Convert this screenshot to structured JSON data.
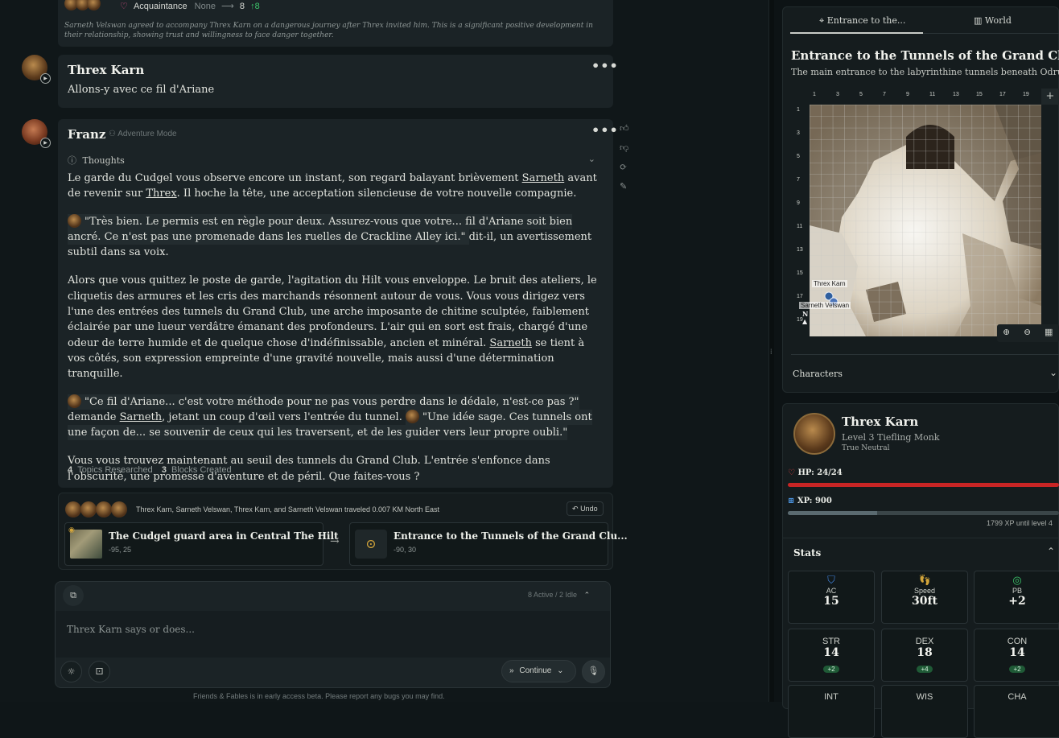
{
  "top_card": {
    "relation_label": "Acquaintance",
    "from_value": "None",
    "arrow": "⟶",
    "to_value": "8",
    "delta": "↑8",
    "note": "Sarneth Velswan agreed to accompany Threx Karn on a dangerous journey after Threx invited him. This is a significant positive development in their relationship, showing trust and willingness to face danger together."
  },
  "msg1": {
    "name": "Threx Karn",
    "text": "Allons-y avec ce fil d'Ariane"
  },
  "msg2": {
    "name": "Franz",
    "mode": "Adventure Mode",
    "thoughts": "Thoughts",
    "p1a": "Le garde du Cudgel vous observe encore un instant, son regard balayant brièvement ",
    "p1b": "Sarneth",
    "p1c": " avant de revenir sur ",
    "p1d": "Threx",
    "p1e": ". Il hoche la tête, une acceptation silencieuse de votre nouvelle compagnie.",
    "q1": "\"Très bien. Le permis est en règle pour deux. Assurez-vous que votre... fil d'Ariane soit bien ancré. Ce n'est pas une promenade dans les ruelles de Crackline Alley ici.\" ",
    "q1tail": " dit-il, un avertissement subtil dans sa voix.",
    "p2a": "Alors que vous quittez le poste de garde, l'agitation du Hilt vous enveloppe. Le bruit des ateliers, le cliquetis des armures et les cris des marchands résonnent autour de vous. Vous vous dirigez vers l'une des entrées des tunnels du Grand Club, une arche imposante de chitine sculptée, faiblement éclairée par une lueur verdâtre émanant des profondeurs. L'air qui en sort est frais, chargé d'une odeur de terre humide et de quelque chose d'indéfinissable, ancien et minéral. ",
    "p2b": "Sarneth",
    "p2c": " se tient à vos côtés, son expression empreinte d'une gravité nouvelle, mais aussi d'une détermination tranquille.",
    "q2": "\"Ce fil d'Ariane... c'est votre méthode pour ne pas vous perdre dans le dédale, n'est-ce pas ?\" ",
    "q2mid": " demande ",
    "q2name": "Sarneth",
    "q2tail": ", jetant un coup d'œil vers l'entrée du tunnel. ",
    "q3": "\"Une idée sage. Ces tunnels ont une façon de... se souvenir de ceux qui les traversent, et de les guider vers leur propre oubli.\"",
    "p3": "Vous vous trouvez maintenant au seuil des tunnels du Grand Club. L'entrée s'enfonce dans l'obscurité, une promesse d'aventure et de péril. Que faites-vous ?",
    "topics_count": "4",
    "topics_label": "Topics Researched",
    "blocks_count": "3",
    "blocks_label": "Blocks Created"
  },
  "travel": {
    "summary": "Threx Karn, Sarneth Velswan, Threx Karn, and Sarneth Velswan traveled 0.007 KM North East",
    "undo": "Undo",
    "from_name": "The Cudgel guard area in Central The Hilt",
    "from_coords": "-95, 25",
    "to_name": "Entrance to the Tunnels of the Grand Clu...",
    "to_coords": "-90, 30"
  },
  "composer": {
    "status": "8 Active / 2 Idle",
    "placeholder": "Threx Karn says or does...",
    "continue": "Continue"
  },
  "footer": "Friends & Fables is in early access beta. Please report any bugs you may find.",
  "right": {
    "tab1": "Entrance to the...",
    "tab2": "World",
    "location_title": "Entrance to the Tunnels of the Grand Club",
    "location_desc": "The main entrance to the labyrinthine tunnels beneath Odrun...",
    "col_labels": [
      "1",
      "3",
      "5",
      "7",
      "9",
      "11",
      "13",
      "15",
      "17",
      "19"
    ],
    "row_labels": [
      "1",
      "3",
      "5",
      "7",
      "9",
      "11",
      "13",
      "15",
      "17",
      "19"
    ],
    "token1": "Threx Karn",
    "token2": "Sarneth Velswan",
    "characters_label": "Characters",
    "char_name": "Threx Karn",
    "char_class": "Level 3 Tiefling Monk",
    "char_align": "True Neutral",
    "hp_label": "HP: 24/24",
    "hp_fraction": 1.0,
    "xp_label": "XP: 900",
    "xp_fraction": 0.33,
    "xp_note": "1799 XP until level 4",
    "stats_label": "Stats",
    "ac": {
      "label": "AC",
      "value": "15"
    },
    "speed": {
      "label": "Speed",
      "value": "30ft"
    },
    "pb": {
      "label": "PB",
      "value": "+2"
    },
    "str": {
      "label": "STR",
      "value": "14",
      "mod": "+2"
    },
    "dex": {
      "label": "DEX",
      "value": "18",
      "mod": "+4"
    },
    "con": {
      "label": "CON",
      "value": "14",
      "mod": "+2"
    },
    "int": {
      "label": "INT"
    },
    "wis": {
      "label": "WIS"
    },
    "cha": {
      "label": "CHA"
    }
  },
  "colors": {
    "hp": "#c82525",
    "xp": "#4a5a60",
    "accent_gold": "#d2a43a",
    "delta_green": "#3cc46a"
  }
}
